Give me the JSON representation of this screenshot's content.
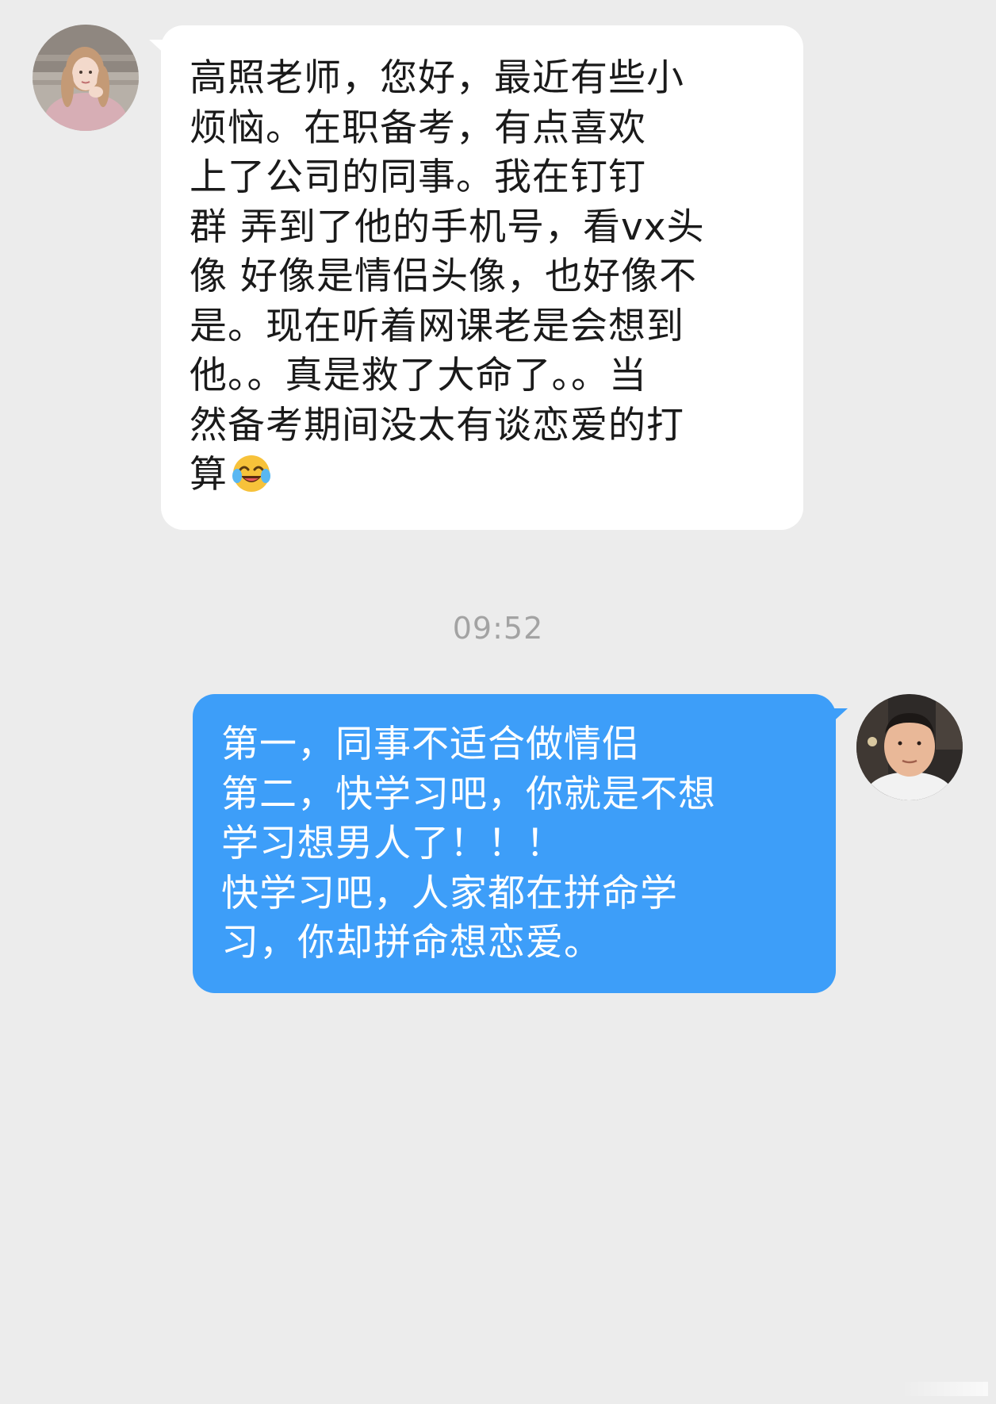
{
  "incoming": {
    "lines": [
      "高照老师，您好，最近有些小",
      "烦恼。在职备考，有点喜欢",
      "上了公司的同事。我在钉钉",
      "群 弄到了他的手机号，看vx头",
      "像 好像是情侣头像，也好像不",
      "是。现在听着网课老是会想到",
      "他。。真是救了大命了。。当",
      "然备考期间没太有谈恋爱的打",
      "算"
    ],
    "emoji": "laughing-crying-emoji"
  },
  "timestamp": "09:52",
  "outgoing": {
    "lines": [
      "第一，同事不适合做情侣",
      "第二，快学习吧，你就是不想",
      "学习想男人了！！！",
      "快学习吧，人家都在拼命学",
      "习，你却拼命想恋爱。"
    ]
  },
  "colors": {
    "background": "#ececec",
    "incoming_bubble": "#ffffff",
    "outgoing_bubble": "#3d9ef9",
    "timestamp_text": "#a3a3a3"
  },
  "icons": {
    "avatar_left": "girl-avatar",
    "avatar_right": "man-avatar"
  }
}
